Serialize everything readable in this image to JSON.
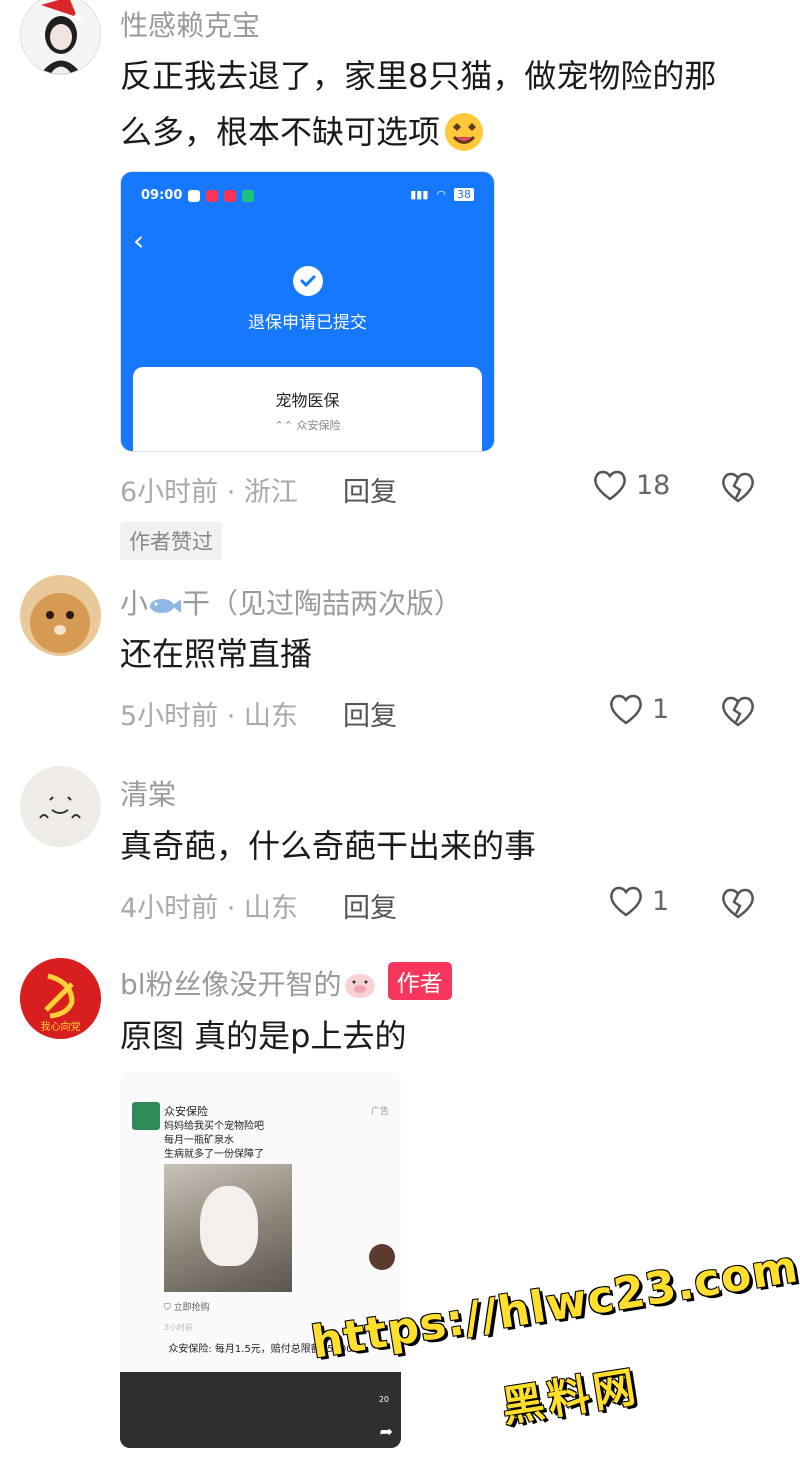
{
  "comments": [
    {
      "username": "性感赖克宝",
      "text_line1": "反正我去退了，家里8只猫，做宠物险的那",
      "text_line2": "么多，根本不缺可选项",
      "emoji": "smile-icon",
      "screenshot": {
        "status_time": "09:00",
        "status_battery": "38",
        "title": "退保申请已提交",
        "card_title": "宠物医保",
        "card_sub": "众安保险"
      },
      "meta": "6小时前 · 浙江",
      "reply_label": "回复",
      "likes": "18",
      "badge": "作者赞过"
    },
    {
      "username_prefix": "小",
      "username_suffix": "干（见过陶喆两次版）",
      "text": "还在照常直播",
      "meta": "5小时前 · 山东",
      "reply_label": "回复",
      "likes": "1"
    },
    {
      "username": "清棠",
      "text": "真奇葩，什么奇葩干出来的事",
      "meta": "4小时前 · 山东",
      "reply_label": "回复",
      "likes": "1"
    },
    {
      "username": "bl粉丝像没开智的",
      "author_tag": "作者",
      "avatar_text": "我心向党",
      "text": "原图 真的是p上去的",
      "screenshot": {
        "brand": "众安保险",
        "ad_label": "广告",
        "line1": "妈妈给我买个宠物险吧",
        "line2": "每月一瓶矿泉水",
        "line3": "生病就多了一份保障了",
        "buy": "立即抢购",
        "time": "3小时前",
        "bar": "众安保险: 每月1.5元，赔付总限额15000",
        "count": "20"
      }
    }
  ],
  "watermark": {
    "url": "https://hlwc23.com",
    "name": "黑料网",
    "color": "#ffdf2b"
  }
}
